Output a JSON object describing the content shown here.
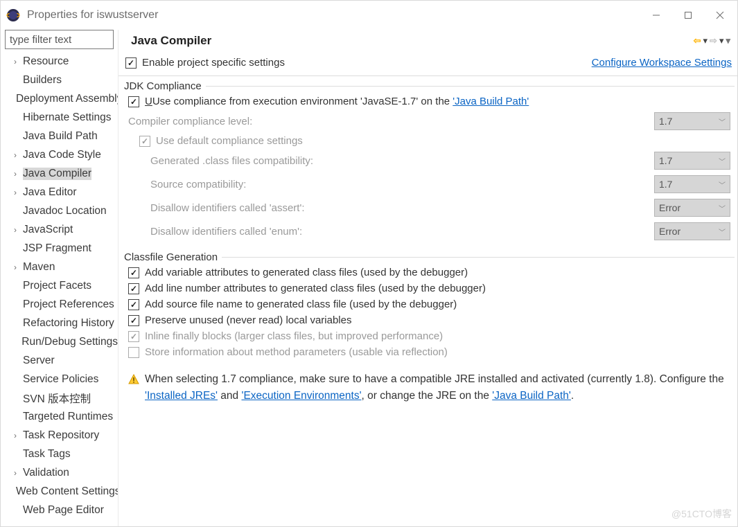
{
  "window": {
    "title": "Properties for iswustserver"
  },
  "filter": {
    "placeholder": "type filter text"
  },
  "tree": [
    {
      "label": "Resource",
      "expandable": true
    },
    {
      "label": "Builders"
    },
    {
      "label": "Deployment Assembly"
    },
    {
      "label": "Hibernate Settings"
    },
    {
      "label": "Java Build Path"
    },
    {
      "label": "Java Code Style",
      "expandable": true
    },
    {
      "label": "Java Compiler",
      "expandable": true,
      "selected": true
    },
    {
      "label": "Java Editor",
      "expandable": true
    },
    {
      "label": "Javadoc Location"
    },
    {
      "label": "JavaScript",
      "expandable": true
    },
    {
      "label": "JSP Fragment"
    },
    {
      "label": "Maven",
      "expandable": true
    },
    {
      "label": "Project Facets"
    },
    {
      "label": "Project References"
    },
    {
      "label": "Refactoring History"
    },
    {
      "label": "Run/Debug Settings"
    },
    {
      "label": "Server"
    },
    {
      "label": "Service Policies"
    },
    {
      "label": "SVN 版本控制"
    },
    {
      "label": "Targeted Runtimes"
    },
    {
      "label": "Task Repository",
      "expandable": true
    },
    {
      "label": "Task Tags"
    },
    {
      "label": "Validation",
      "expandable": true
    },
    {
      "label": "Web Content Settings"
    },
    {
      "label": "Web Page Editor"
    }
  ],
  "page": {
    "title": "Java Compiler",
    "enable_specific": "Enable project specific settings",
    "configure_workspace": "Configure Workspace Settings",
    "jdk_group": "JDK Compliance",
    "use_compliance_prefix": "Use compliance from execution environment 'JavaSE-1.7' on the ",
    "java_build_path_link": "'Java Build Path'",
    "compiler_level_label": "Compiler compliance level:",
    "compiler_level_value": "1.7",
    "use_default": "Use default compliance settings",
    "gen_class_label": "Generated .class files compatibility:",
    "gen_class_value": "1.7",
    "source_compat_label": "Source compatibility:",
    "source_compat_value": "1.7",
    "disallow_assert_label": "Disallow identifiers called 'assert':",
    "disallow_assert_value": "Error",
    "disallow_enum_label": "Disallow identifiers called 'enum':",
    "disallow_enum_value": "Error",
    "classfile_group": "Classfile Generation",
    "cf_var": "Add variable attributes to generated class files (used by the debugger)",
    "cf_line": "Add line number attributes to generated class files (used by the debugger)",
    "cf_src": "Add source file name to generated class file (used by the debugger)",
    "cf_preserve": "Preserve unused (never read) local variables",
    "cf_inline": "Inline finally blocks (larger class files, but improved performance)",
    "cf_store": "Store information about method parameters (usable via reflection)",
    "warning_pre": "When selecting 1.7 compliance, make sure to have a compatible JRE installed and activated (currently 1.8). Configure the ",
    "warning_link1": "'Installed JREs'",
    "warning_mid": " and ",
    "warning_link2": "'Execution Environments'",
    "warning_post": ", or change the JRE on the ",
    "warning_link3": "'Java Build Path'",
    "warning_end": "."
  },
  "watermark": "@51CTO博客"
}
